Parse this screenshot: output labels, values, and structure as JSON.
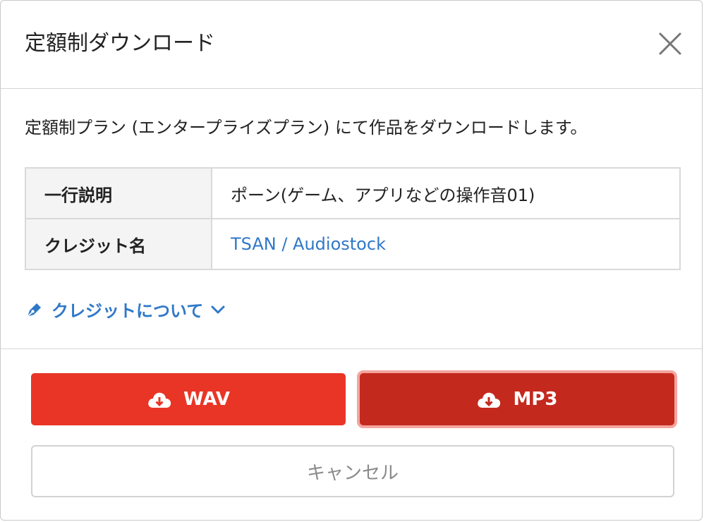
{
  "dialog": {
    "title": "定額制ダウンロード",
    "description": "定額制プラン (エンタープライズプラン) にて作品をダウンロードします。",
    "info_rows": [
      {
        "label": "一行説明",
        "value": "ポーン(ゲーム、アプリなどの操作音01)"
      },
      {
        "label": "クレジット名",
        "value": "TSAN / Audiostock"
      }
    ],
    "credit_about": "クレジットについて",
    "buttons": {
      "wav": "WAV",
      "mp3": "MP3",
      "cancel": "キャンセル"
    }
  },
  "colors": {
    "primary_red": "#e93526",
    "primary_red_pressed": "#c4291e",
    "link_blue": "#2f78c8"
  },
  "icons": {
    "close": "close-icon",
    "pen": "pen-icon",
    "chevron": "chevron-down-icon",
    "download_cloud": "cloud-download-icon"
  }
}
